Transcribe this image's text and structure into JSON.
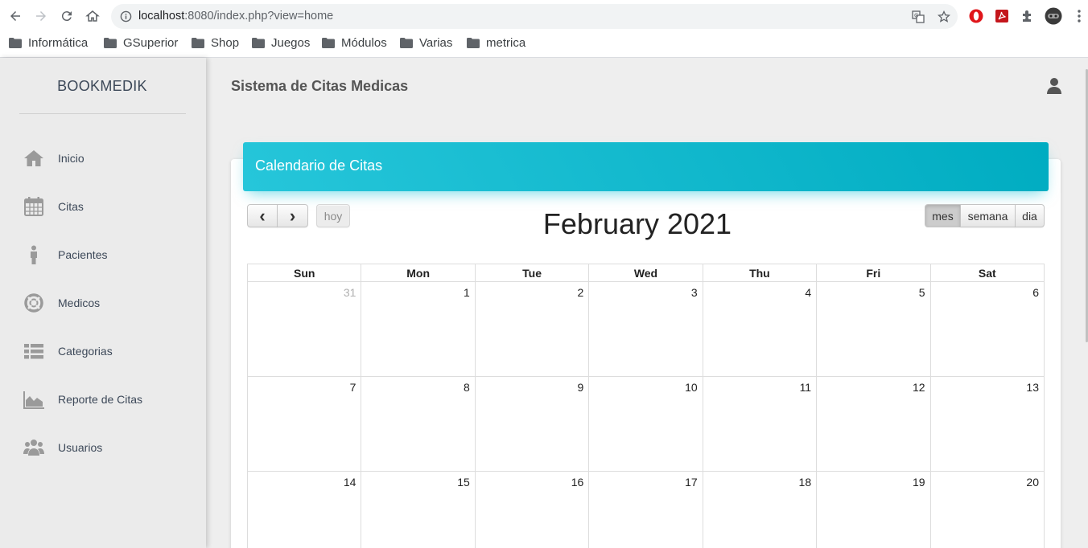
{
  "browser": {
    "url_host": "localhost",
    "url_rest": ":8080/index.php?view=home",
    "bookmarks": [
      "Informática",
      "GSuperior",
      "Shop",
      "Juegos",
      "Módulos",
      "Varias",
      "metrica"
    ]
  },
  "sidebar": {
    "brand": "BOOKMEDIK",
    "items": [
      {
        "label": "Inicio",
        "icon": "home-icon"
      },
      {
        "label": "Citas",
        "icon": "calendar-icon"
      },
      {
        "label": "Pacientes",
        "icon": "person-icon"
      },
      {
        "label": "Medicos",
        "icon": "life-ring-icon"
      },
      {
        "label": "Categorias",
        "icon": "list-icon"
      },
      {
        "label": "Reporte de Citas",
        "icon": "area-chart-icon"
      },
      {
        "label": "Usuarios",
        "icon": "users-icon"
      }
    ]
  },
  "header": {
    "title": "Sistema de Citas Medicas"
  },
  "card": {
    "title": "Calendario de Citas"
  },
  "calendar": {
    "title": "February 2021",
    "prev_label": "‹",
    "next_label": "›",
    "today_label": "hoy",
    "views": {
      "month": "mes",
      "week": "semana",
      "day": "dia"
    },
    "active_view": "mes",
    "weekdays": [
      "Sun",
      "Mon",
      "Tue",
      "Wed",
      "Thu",
      "Fri",
      "Sat"
    ],
    "weeks": [
      [
        "31",
        "1",
        "2",
        "3",
        "4",
        "5",
        "6"
      ],
      [
        "7",
        "8",
        "9",
        "10",
        "11",
        "12",
        "13"
      ],
      [
        "14",
        "15",
        "16",
        "17",
        "18",
        "19",
        "20"
      ]
    ],
    "other_month_days": [
      "31"
    ]
  },
  "colors": {
    "accent": "#00bcd4",
    "sidebar_bg": "#ebebeb",
    "page_bg": "#eeeeee"
  }
}
